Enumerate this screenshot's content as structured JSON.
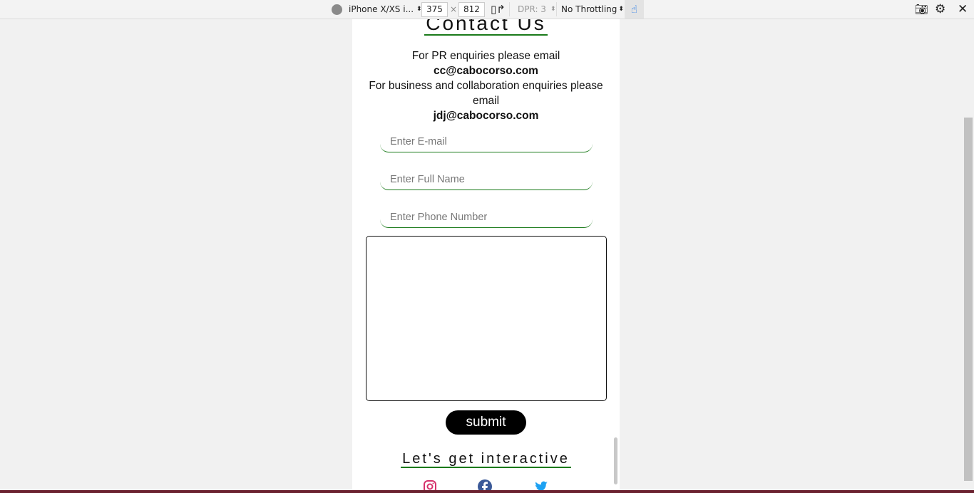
{
  "devtools": {
    "device": "iPhone X/XS i...",
    "width": "375",
    "times": "×",
    "height": "812",
    "dpr": "DPR: 3",
    "throttling": "No Throttling",
    "colors": {
      "accent": "#1a73e8"
    }
  },
  "page": {
    "title": "Contact Us",
    "line1": "For PR enquiries please email",
    "email1": "cc@cabocorso.com",
    "line2": "For business and collaboration enquiries please email",
    "email2": "jdj@cabocorso.com",
    "email_placeholder": "Enter E-mail",
    "name_placeholder": "Enter Full Name",
    "phone_placeholder": "Enter Phone Number",
    "submit": "submit",
    "social_title": "Let's get interactive",
    "socials": [
      "instagram-icon",
      "facebook-icon",
      "twitter-icon"
    ],
    "colors": {
      "underline": "#1a7a1a",
      "instagram": "#d6336c",
      "facebook": "#3b5998",
      "twitter": "#1da1f2"
    }
  }
}
